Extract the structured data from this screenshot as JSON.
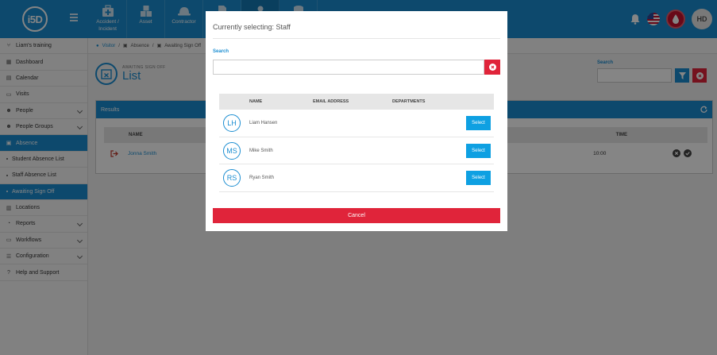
{
  "app": {
    "logo_text": "i5D"
  },
  "topnav": [
    {
      "label": "Accident / Incident",
      "icon": "first-aid-kit-icon"
    },
    {
      "label": "Asset",
      "icon": "boxes-icon"
    },
    {
      "label": "Contractor",
      "icon": "hard-hat-icon"
    },
    {
      "label": "",
      "icon": "document-icon"
    },
    {
      "label": "",
      "icon": "person-icon"
    },
    {
      "label": "",
      "icon": "database-icon"
    }
  ],
  "user": {
    "initials": "HD"
  },
  "sidebar": {
    "items": [
      {
        "label": "Liam's training",
        "icon": "fork-icon"
      },
      {
        "label": "Dashboard",
        "icon": "dashboard-icon"
      },
      {
        "label": "Calendar",
        "icon": "calendar-icon"
      },
      {
        "label": "Visits",
        "icon": "visits-icon"
      },
      {
        "label": "People",
        "icon": "people-icon"
      },
      {
        "label": "People Groups",
        "icon": "people-groups-icon"
      },
      {
        "label": "Absence",
        "icon": "absence-icon"
      },
      {
        "label": "Student Absence List"
      },
      {
        "label": "Staff Absence List"
      },
      {
        "label": "Awaiting Sign Off"
      },
      {
        "label": "Locations",
        "icon": "locations-icon"
      },
      {
        "label": "Reports",
        "icon": "reports-icon"
      },
      {
        "label": "Workflows",
        "icon": "workflows-icon"
      },
      {
        "label": "Configuration",
        "icon": "configuration-icon"
      },
      {
        "label": "Help and Support",
        "icon": "help-icon"
      }
    ]
  },
  "breadcrumb": {
    "home": "Visitor",
    "level1": "Absence",
    "level2": "Awaiting Sign Off"
  },
  "page": {
    "subtitle": "AWAITING SIGN OFF",
    "title": "List"
  },
  "search": {
    "label": "Search"
  },
  "results": {
    "title": "Results",
    "headers": {
      "name": "NAME",
      "time": "TIME"
    },
    "rows": [
      {
        "name": "Jonna Smith",
        "time": "10:00"
      }
    ]
  },
  "modal": {
    "title": "Currently selecting:  Staff",
    "search_label": "Search",
    "search_value": "",
    "headers": {
      "name": "NAME",
      "email": "EMAIL ADDRESS",
      "departments": "DEPARTMENTS"
    },
    "rows": [
      {
        "initials": "LH",
        "name": "Liam Hansen",
        "select_label": "Select"
      },
      {
        "initials": "MS",
        "name": "Mike Smith",
        "select_label": "Select"
      },
      {
        "initials": "RS",
        "name": "Ryan Smith",
        "select_label": "Select"
      }
    ],
    "cancel_label": "Cancel"
  },
  "colors": {
    "primary": "#1a8dd1",
    "danger": "#e0243a",
    "select": "#0ea0e2"
  }
}
